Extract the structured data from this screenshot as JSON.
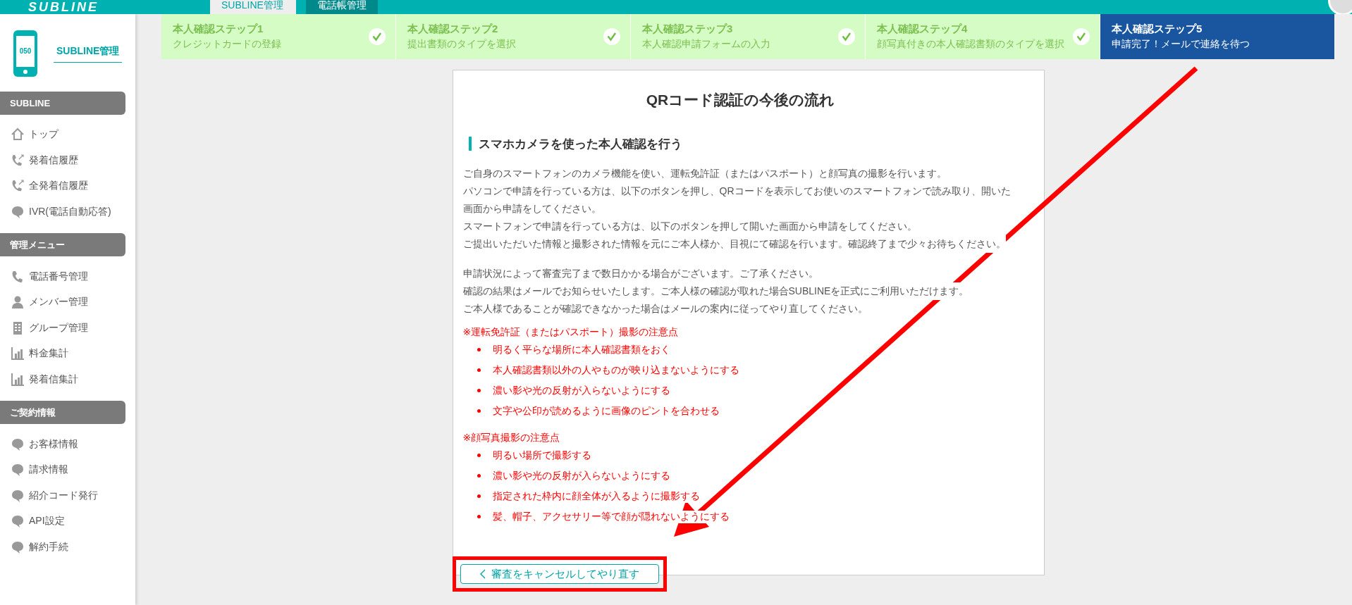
{
  "header": {
    "logo_text": "SUBLINE",
    "tabs": [
      {
        "label": "SUBLINE管理",
        "selected": true
      },
      {
        "label": "電話帳管理",
        "selected": false
      }
    ]
  },
  "sidebar": {
    "brand": "SUBLINE管理",
    "phone_number_label": "050",
    "sections": [
      {
        "title": "SUBLINE",
        "items": [
          {
            "label": "トップ",
            "kind": "home"
          },
          {
            "label": "発着信履歴",
            "kind": "call-log"
          },
          {
            "label": "全発着信履歴",
            "kind": "call-log"
          },
          {
            "label": "IVR(電話自動応答)",
            "kind": "bubble"
          }
        ]
      },
      {
        "title": "管理メニュー",
        "items": [
          {
            "label": "電話番号管理",
            "kind": "phone"
          },
          {
            "label": "メンバー管理",
            "kind": "person"
          },
          {
            "label": "グループ管理",
            "kind": "building"
          },
          {
            "label": "料金集計",
            "kind": "chart"
          },
          {
            "label": "発着信集計",
            "kind": "chart"
          }
        ]
      },
      {
        "title": "ご契約情報",
        "items": [
          {
            "label": "お客様情報",
            "kind": "bubble"
          },
          {
            "label": "請求情報",
            "kind": "bubble"
          },
          {
            "label": "紹介コード発行",
            "kind": "bubble"
          },
          {
            "label": "API設定",
            "kind": "bubble"
          },
          {
            "label": "解約手続",
            "kind": "bubble"
          }
        ]
      }
    ]
  },
  "steps": [
    {
      "title": "本人確認ステップ1",
      "subtitle": "クレジットカードの登録",
      "completed": true,
      "selected": false
    },
    {
      "title": "本人確認ステップ2",
      "subtitle": "提出書類のタイプを選択",
      "completed": true,
      "selected": false
    },
    {
      "title": "本人確認ステップ3",
      "subtitle": "本人確認申請フォームの入力",
      "completed": true,
      "selected": false
    },
    {
      "title": "本人確認ステップ4",
      "subtitle": "顔写真付きの本人確認書類のタイプを選択",
      "completed": true,
      "selected": false
    },
    {
      "title": "本人確認ステップ5",
      "subtitle": "申請完了！メールで連絡を待つ",
      "completed": false,
      "selected": true
    }
  ],
  "content": {
    "title": "QRコード認証の今後の流れ",
    "section_heading": "スマホカメラを使った本人確認を行う",
    "paragraphs": [
      [
        "ご自身のスマートフォンのカメラ機能を使い、運転免許証（またはパスポート）と顔写真の撮影を行います。",
        "パソコンで申請を行っている方は、以下のボタンを押し、QRコードを表示してお使いのスマートフォンで読み取り、開いた画面から申請をしてください。",
        "スマートフォンで申請を行っている方は、以下のボタンを押して開いた画面から申請をしてください。",
        "ご提出いただいた情報と撮影された情報を元にご本人様か、目視にて確認を行います。確認終了まで少々お待ちください。"
      ],
      [
        "申請状況によって審査完了まで数日かかる場合がございます。ご了承ください。",
        "確認の結果はメールでお知らせいたします。ご本人様の確認が取れた場合SUBLINEを正式にご利用いただけます。",
        "ご本人様であることが確認できなかった場合はメールの案内に従ってやり直してください。"
      ]
    ],
    "notices": [
      {
        "heading": "※運転免許証（またはパスポート）撮影の注意点",
        "items": [
          "明るく平らな場所に本人確認書類をおく",
          "本人確認書類以外の人やものが映り込まないようにする",
          "濃い影や光の反射が入らないようにする",
          "文字や公印が読めるように画像のピントを合わせる"
        ]
      },
      {
        "heading": "※顔写真撮影の注意点",
        "items": [
          "明るい場所で撮影する",
          "濃い影や光の反射が入らないようにする",
          "指定された枠内に顔全体が入るように撮影する",
          "髪、帽子、アクセサリー等で顔が隠れないようにする"
        ]
      }
    ],
    "cancel_button": "審査をキャンセルしてやり直す"
  }
}
